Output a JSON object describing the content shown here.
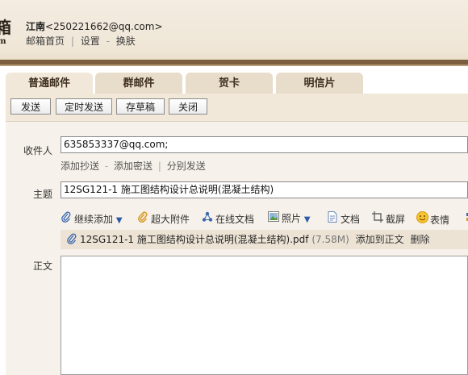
{
  "header": {
    "logo_big": "箱",
    "logo_small": "m",
    "user_name": "江南",
    "user_email": "<250221662@qq.com>",
    "links": [
      "邮箱首页",
      "设置",
      "换肤"
    ],
    "link_seps": [
      "|",
      "-"
    ]
  },
  "tabs": [
    {
      "label": "普通邮件",
      "active": true
    },
    {
      "label": "群邮件",
      "active": false
    },
    {
      "label": "贺卡",
      "active": false
    },
    {
      "label": "明信片",
      "active": false
    }
  ],
  "toolbar": {
    "send": "发送",
    "scheduled_send": "定时发送",
    "save_draft": "存草稿",
    "close": "关闭"
  },
  "form": {
    "to_label": "收件人",
    "to_value": "635853337@qq.com;",
    "cc_links": [
      "添加抄送",
      "添加密送",
      "分别发送"
    ],
    "cc_seps": [
      "-",
      "|"
    ],
    "subject_label": "主题",
    "subject_value": "12SG121-1 施工图结构设计总说明(混凝土结构)",
    "body_label": "正文"
  },
  "tools": [
    {
      "label": "继续添加",
      "icon": "paperclip-icon"
    },
    {
      "label": "超大附件",
      "icon": "big-attachment-icon"
    },
    {
      "label": "在线文档",
      "icon": "online-doc-icon"
    },
    {
      "label": "照片",
      "icon": "photo-icon"
    },
    {
      "label": "文档",
      "icon": "document-icon"
    },
    {
      "label": "截屏",
      "icon": "screenshot-icon"
    },
    {
      "label": "表情",
      "icon": "emoticon-icon"
    }
  ],
  "attachment": {
    "filename": "12SG121-1 施工图结构设计总说明(混凝土结构).pdf",
    "size": "(7.58M)",
    "add_to_body": "添加到正文",
    "delete": "删除"
  },
  "colors": {
    "header_bg": "#efe6d6",
    "header_bar": "#7b5e3d",
    "tab_bg": "#e8dcca",
    "form_bg": "#f6f1ea",
    "icon_blue": "#3a68b0"
  }
}
